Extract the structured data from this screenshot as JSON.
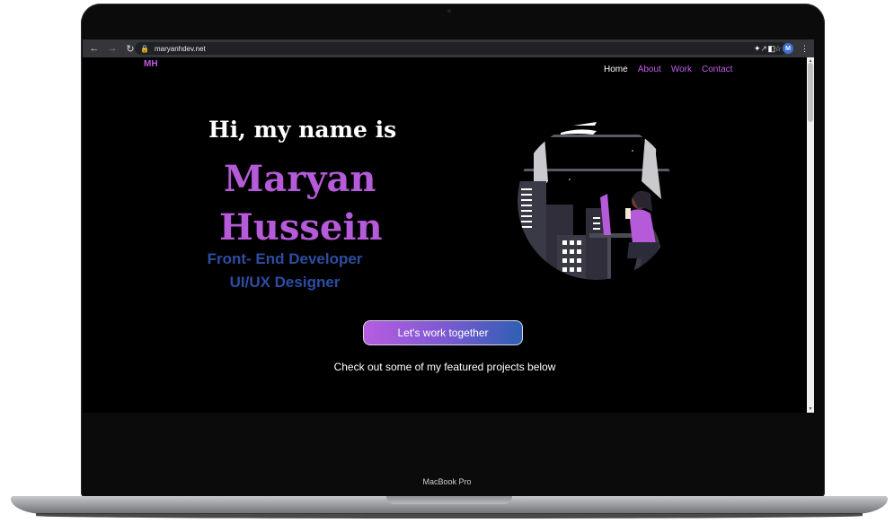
{
  "browser": {
    "url": "maryanhdev.net",
    "avatar_letter": "M"
  },
  "site": {
    "logo": "MH",
    "nav": [
      "Home",
      "About",
      "Work",
      "Contact"
    ],
    "greeting": "Hi, my name is",
    "name_line1": "Maryan",
    "name_line2": "Hussein",
    "roles": [
      "Front- End Developer",
      "UI/UX Designer"
    ],
    "cta_label": "Let's work together",
    "subtitle": "Check out some of my featured projects below"
  },
  "device": {
    "model_label": "MacBook Pro"
  },
  "colors": {
    "accent_purple": "#b55ad8",
    "role_blue": "#2d4da3",
    "background": "#000000"
  }
}
